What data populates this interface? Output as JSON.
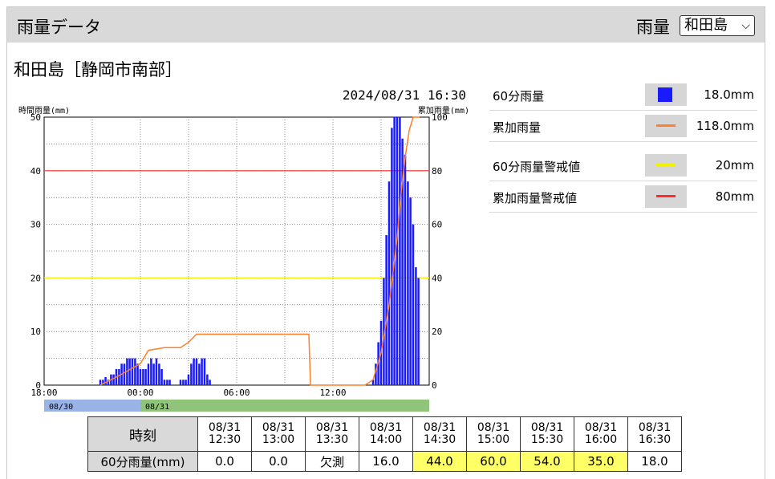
{
  "header": {
    "title": "雨量データ",
    "select_label": "雨量",
    "selected_station": "和田島"
  },
  "station_title": "和田島［静岡市南部］",
  "chart_data": {
    "type": "bar",
    "timestamp": "2024/08/31  16:30",
    "left_axis_label": "時間雨量(mm)",
    "right_axis_label": "累加雨量(mm)",
    "ylim_left": [
      0,
      50
    ],
    "ylim_right": [
      0,
      100
    ],
    "left_ticks": [
      "50",
      "40",
      "30",
      "20",
      "10",
      "0"
    ],
    "right_ticks": [
      "100",
      "80",
      "60",
      "40",
      "20",
      "0"
    ],
    "x_tick_labels": [
      "18:00",
      "00:00",
      "06:00",
      "12:00"
    ],
    "date_labels": [
      "08/30",
      "08/31"
    ],
    "date_colors": [
      "#99b3e6",
      "#8fc47a"
    ],
    "warning_60min": 20,
    "warning_cumulative": 80,
    "bar_color": "#1a1aff",
    "cumulative_color": "#ff7f2a",
    "warn60_color": "#f2f200",
    "warncum_color": "#ff2a2a",
    "hourly_bars": [
      [
        3.5,
        1
      ],
      [
        3.67,
        1
      ],
      [
        3.83,
        1.5
      ],
      [
        4.0,
        1
      ],
      [
        4.17,
        2
      ],
      [
        4.33,
        2
      ],
      [
        4.5,
        3
      ],
      [
        4.67,
        3
      ],
      [
        4.83,
        4
      ],
      [
        5.0,
        4
      ],
      [
        5.17,
        5
      ],
      [
        5.33,
        5
      ],
      [
        5.5,
        5
      ],
      [
        5.67,
        5
      ],
      [
        5.83,
        4
      ],
      [
        6.0,
        3
      ],
      [
        6.17,
        3
      ],
      [
        6.33,
        3
      ],
      [
        6.5,
        4
      ],
      [
        6.67,
        5
      ],
      [
        6.83,
        4
      ],
      [
        7.0,
        5
      ],
      [
        7.17,
        4
      ],
      [
        7.33,
        3
      ],
      [
        7.5,
        1
      ],
      [
        7.67,
        1
      ],
      [
        7.83,
        1
      ],
      [
        8.5,
        1
      ],
      [
        8.67,
        1
      ],
      [
        8.83,
        1
      ],
      [
        9.0,
        2
      ],
      [
        9.17,
        4
      ],
      [
        9.33,
        5
      ],
      [
        9.5,
        5
      ],
      [
        9.67,
        4
      ],
      [
        9.83,
        5
      ],
      [
        10.0,
        5
      ],
      [
        10.17,
        2
      ],
      [
        10.33,
        1
      ],
      [
        20.5,
        1
      ],
      [
        20.67,
        4
      ],
      [
        20.83,
        8
      ],
      [
        21.0,
        12
      ],
      [
        21.17,
        20
      ],
      [
        21.33,
        28
      ],
      [
        21.5,
        38
      ],
      [
        21.67,
        48
      ],
      [
        21.83,
        50
      ],
      [
        22.0,
        50
      ],
      [
        22.17,
        50
      ],
      [
        22.33,
        46
      ],
      [
        22.5,
        43
      ],
      [
        22.67,
        38
      ],
      [
        22.83,
        35
      ],
      [
        23.0,
        30
      ],
      [
        23.17,
        22
      ],
      [
        23.33,
        20
      ]
    ],
    "cumulative_line": [
      [
        3.5,
        0
      ],
      [
        4.5,
        3
      ],
      [
        6.0,
        8
      ],
      [
        6.5,
        13
      ],
      [
        7.5,
        14
      ],
      [
        8.5,
        14
      ],
      [
        9.0,
        16
      ],
      [
        9.5,
        19
      ],
      [
        10.5,
        19
      ],
      [
        12.5,
        19
      ],
      [
        14.5,
        19
      ],
      [
        15.5,
        19
      ],
      [
        16.5,
        19
      ],
      [
        16.6,
        0
      ],
      [
        20.0,
        0
      ],
      [
        20.5,
        2
      ],
      [
        21.0,
        12
      ],
      [
        21.5,
        30
      ],
      [
        22.0,
        55
      ],
      [
        22.25,
        72
      ],
      [
        22.5,
        85
      ],
      [
        22.75,
        95
      ],
      [
        23.0,
        100
      ],
      [
        23.4,
        100
      ]
    ]
  },
  "legend": [
    {
      "label": "60分雨量",
      "value": "18.0mm",
      "kind": "square",
      "color": "#1a1aff"
    },
    {
      "label": "累加雨量",
      "value": "118.0mm",
      "kind": "line",
      "color": "#ff7f2a"
    },
    {
      "label": "60分雨量警戒値",
      "value": "20mm",
      "kind": "line",
      "color": "#f2f200"
    },
    {
      "label": "累加雨量警戒値",
      "value": "80mm",
      "kind": "line",
      "color": "#ff2a2a"
    }
  ],
  "table": {
    "time_header": "時刻",
    "row_header": "60分雨量(mm)",
    "times": [
      [
        "08/31",
        "12:30"
      ],
      [
        "08/31",
        "13:00"
      ],
      [
        "08/31",
        "13:30"
      ],
      [
        "08/31",
        "14:00"
      ],
      [
        "08/31",
        "14:30"
      ],
      [
        "08/31",
        "15:00"
      ],
      [
        "08/31",
        "15:30"
      ],
      [
        "08/31",
        "16:00"
      ],
      [
        "08/31",
        "16:30"
      ]
    ],
    "values": [
      "0.0",
      "0.0",
      "欠測",
      "16.0",
      "44.0",
      "60.0",
      "54.0",
      "35.0",
      "18.0"
    ],
    "highlight": [
      false,
      false,
      false,
      false,
      true,
      true,
      true,
      true,
      false
    ]
  }
}
